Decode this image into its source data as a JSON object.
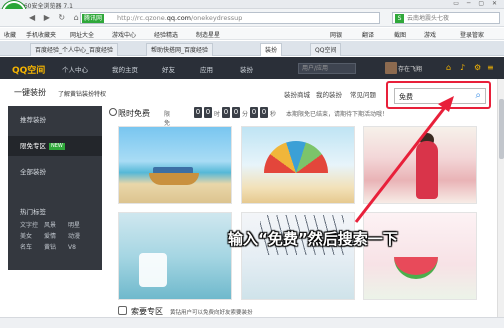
{
  "browser": {
    "title": "360安全浏览器 7.1",
    "window_controls": "▭ ─ ▢ ✕",
    "nav_arrows": "◀ ▶ ↻ ⌂",
    "url_badge": "腾讯网",
    "url_prefix": "http://rc.qzone.",
    "url_domain": "qq.com",
    "url_suffix": "/onekeydressup",
    "search_text": "云南地震头七夜",
    "bookmarks": [
      "收藏",
      "手机收藏夹",
      "网址大全",
      "游戏中心",
      "经验精选",
      "制造星星",
      "网银",
      "翻译",
      "截图",
      "游戏",
      "登录管家"
    ],
    "tabs": [
      "百度经验_个人中心_百度经验",
      "帮助快搭网_百度经验",
      "装扮",
      "QQ空间"
    ]
  },
  "qzone": {
    "brand": "QQ空间",
    "nav": [
      "个人中心",
      "我的主页",
      "好友",
      "应用",
      "装扮"
    ],
    "search_placeholder": "用户/应用",
    "user_name": "存在飞翔"
  },
  "subheader": {
    "title": "一键装扮",
    "perk_link": "了解黄钻装扮特权",
    "links": [
      "装扮商城",
      "我的装扮",
      "常见问题"
    ]
  },
  "search": {
    "value": "免费",
    "button_icon": "search-icon"
  },
  "sidebar": {
    "items": [
      {
        "label": "推荐装扮",
        "selected": false
      },
      {
        "label": "限免专区",
        "selected": true,
        "badge": "NEW"
      },
      {
        "label": "全部装扮",
        "selected": false
      }
    ],
    "hot_label": "热门标签",
    "tags": [
      "文字控",
      "风景",
      "明星",
      "美女",
      "爱情",
      "动漫",
      "名车",
      "黄钻",
      "V8"
    ]
  },
  "flash_sale": {
    "label": "限时免费",
    "countdown_prefix": "限免还剩",
    "days": [
      "0",
      "0"
    ],
    "days_unit": "时",
    "minutes": [
      "0",
      "0"
    ],
    "minutes_unit": "分",
    "seconds": [
      "0",
      "0"
    ],
    "seconds_unit": "秒",
    "desc": "本期限免已结束，请期待下期活动哦！"
  },
  "annotation": {
    "callout": "输入“免费”然后搜索一下"
  },
  "bottom": {
    "title": "索要专区",
    "desc": "黄钻用户可以免费向好友索要装扮"
  },
  "colors": {
    "annotation_red": "#e8203a",
    "qzone_gold": "#f5b400",
    "brand_green": "#2fa83a"
  }
}
